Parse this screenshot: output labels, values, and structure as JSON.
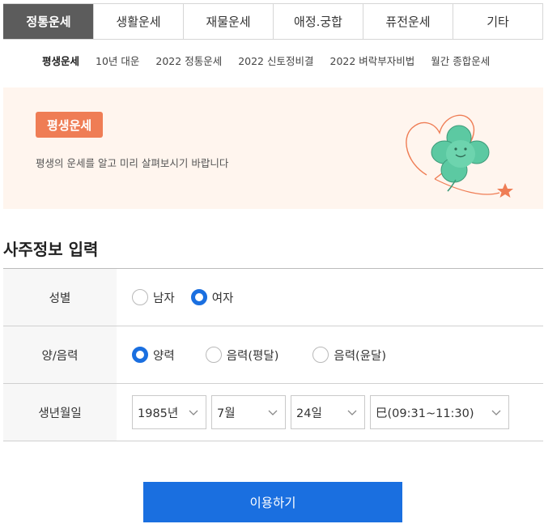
{
  "top_tabs": [
    {
      "label": "정통운세",
      "active": true
    },
    {
      "label": "생활운세",
      "active": false
    },
    {
      "label": "재물운세",
      "active": false
    },
    {
      "label": "애정.궁합",
      "active": false
    },
    {
      "label": "퓨전운세",
      "active": false
    },
    {
      "label": "기타",
      "active": false
    }
  ],
  "sub_nav": [
    {
      "label": "평생운세",
      "active": true
    },
    {
      "label": "10년 대운",
      "active": false
    },
    {
      "label": "2022 정통운세",
      "active": false
    },
    {
      "label": "2022 신토정비결",
      "active": false
    },
    {
      "label": "2022 벼락부자비법",
      "active": false
    },
    {
      "label": "월간 종합운세",
      "active": false
    }
  ],
  "banner": {
    "badge": "평생운세",
    "description": "평생의 운세를 알고 미리 살펴보시기 바랍니다",
    "illustration_icon": "heart-clover-character-icon",
    "colors": {
      "background": "#fff5ee",
      "badge": "#ef7d55",
      "clover": "#5cc9a2"
    }
  },
  "section_title": "사주정보 입력",
  "form": {
    "gender": {
      "label": "성별",
      "options": [
        {
          "label": "남자",
          "checked": false
        },
        {
          "label": "여자",
          "checked": true
        }
      ]
    },
    "calendar": {
      "label": "양/음력",
      "options": [
        {
          "label": "양력",
          "checked": true
        },
        {
          "label": "음력(평달)",
          "checked": false
        },
        {
          "label": "음력(윤달)",
          "checked": false
        }
      ]
    },
    "birth": {
      "label": "생년월일",
      "year": "1985년",
      "month": "7월",
      "day": "24일",
      "hour": "巳(09:31~11:30)"
    }
  },
  "submit_label": "이용하기",
  "accent_color": "#1a6fe0"
}
